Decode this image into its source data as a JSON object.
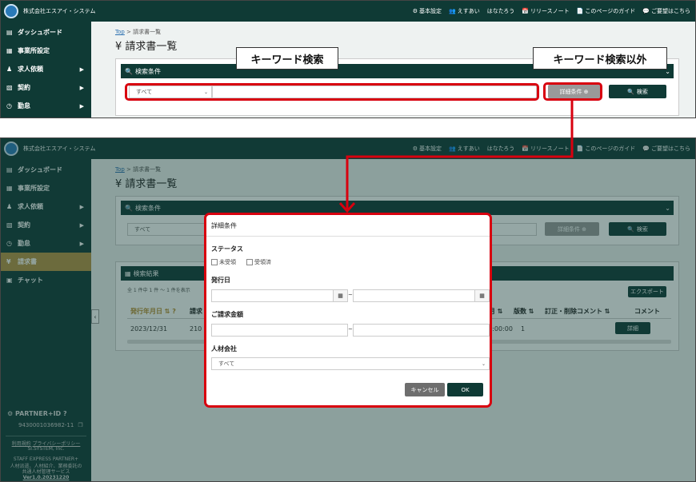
{
  "app": {
    "company": "株式会社エスアイ・システム",
    "topnav": [
      {
        "icon": "gear-icon",
        "glyph": "⚙",
        "label": "基本設定"
      },
      {
        "icon": "users-icon",
        "glyph": "👥",
        "label": "えすあい"
      },
      {
        "icon": "",
        "glyph": "",
        "label": "はなたろう"
      },
      {
        "icon": "calendar-icon",
        "glyph": "📅",
        "label": "リリースノート"
      },
      {
        "icon": "document-icon",
        "glyph": "📄",
        "label": "このページのガイド"
      },
      {
        "icon": "comment-icon",
        "glyph": "💬",
        "label": "ご要望はこちら"
      }
    ]
  },
  "sidebar": {
    "items": [
      {
        "icon": "dashboard-icon",
        "glyph": "▤",
        "label": "ダッシュボード",
        "arrow": ""
      },
      {
        "icon": "building-icon",
        "glyph": "▦",
        "label": "事業所設定",
        "arrow": ""
      },
      {
        "icon": "people-icon",
        "glyph": "♟",
        "label": "求人依頼",
        "arrow": "▶"
      },
      {
        "icon": "contract-icon",
        "glyph": "▧",
        "label": "契約",
        "arrow": "▶"
      },
      {
        "icon": "clock-icon",
        "glyph": "◷",
        "label": "勤怠",
        "arrow": "▶"
      },
      {
        "icon": "yen-icon",
        "glyph": "¥",
        "label": "請求書",
        "arrow": ""
      },
      {
        "icon": "chat-icon",
        "glyph": "▣",
        "label": "チャット",
        "arrow": ""
      }
    ],
    "partner_label": "PARTNER+ID",
    "partner_id": "9430001036982-11",
    "terms": "利用規約",
    "privacy": "プライバシーポリシー",
    "copyright": "SI.SYSTEM, Inc.",
    "desc1": "STAFF EXPRESS PARTNER+",
    "desc2": "人材派遣、人材紹介、業務委託の",
    "desc3": "共通人材管理サービス",
    "version": "Ver1.0.20231220"
  },
  "page": {
    "breadcrumb_top": "Top",
    "breadcrumb_sep": ">",
    "breadcrumb_current": "請求書一覧",
    "title": "¥ 請求書一覧",
    "search_title": "検索条件",
    "select_all": "すべて",
    "detail_button": "詳細条件 ⊕",
    "search_button": "検索",
    "results_title": "検索結果",
    "results_count": "全 1 件中 1 件 ～ 1 件を表示",
    "export_button": "エクスポート"
  },
  "callouts": {
    "keyword": "キーワード検索",
    "other": "キーワード検索以外"
  },
  "table": {
    "headers": [
      "発行年月日",
      "請求",
      "月 ⇅",
      "版数 ⇅",
      "訂正・削除コメント ⇅",
      "コメント"
    ],
    "row": [
      "2023/12/31",
      "210",
      "00:00:00",
      "1",
      "",
      ""
    ],
    "detail_button": "詳細"
  },
  "modal": {
    "title": "詳細条件",
    "status_label": "ステータス",
    "status_opt1": "未受領",
    "status_opt2": "受領済",
    "issue_date_label": "発行日",
    "amount_label": "ご請求金額",
    "agency_label": "人材会社",
    "agency_value": "すべて",
    "tilde": "~",
    "cancel_button": "キャンセル",
    "ok_button": "OK"
  }
}
